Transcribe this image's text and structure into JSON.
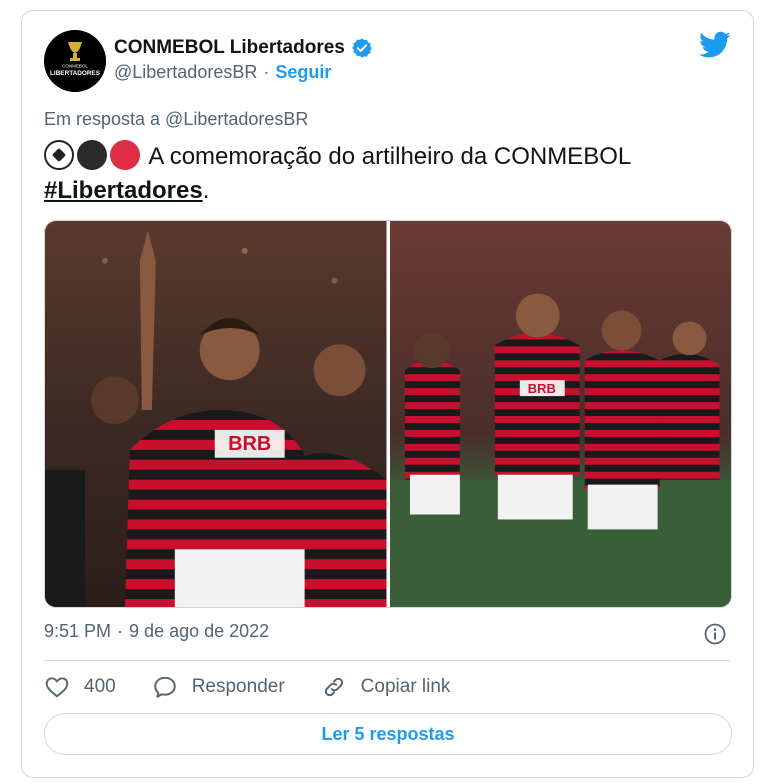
{
  "author": {
    "display_name": "CONMEBOL Libertadores",
    "handle": "@LibertadoresBR",
    "separator": "·",
    "follow_label": "Seguir",
    "avatar_text_small": "CONMEBOL",
    "avatar_text": "LIBERTADORES",
    "verified_icon": "verified-badge-icon",
    "brand_icon": "twitter-bird-icon"
  },
  "tweet": {
    "reply_context": "Em resposta a @LibertadoresBR",
    "emojis": [
      "soccer-ball-emoji",
      "black-circle-emoji",
      "red-circle-emoji"
    ],
    "text": "A comemoração do artilheiro da CONMEBOL ",
    "hashtag": "#Libertadores",
    "text_end": ".",
    "time": "9:51 PM",
    "date_separator": "·",
    "date": "9 de ago de 2022"
  },
  "media": {
    "photos": [
      {
        "kind": "photo",
        "jersey_text": "BRB"
      },
      {
        "kind": "photo",
        "jersey_text": "BRB"
      }
    ]
  },
  "actions": {
    "like_count": "400",
    "reply_label": "Responder",
    "copy_link_label": "Copiar link",
    "read_replies_label": "Ler 5 respostas"
  },
  "colors": {
    "accent": "#1d9bf0",
    "text": "#0f1419",
    "muted": "#536471",
    "border": "#cfd9de",
    "jersey_red": "#c8102e",
    "jersey_black": "#1a1a1a"
  }
}
